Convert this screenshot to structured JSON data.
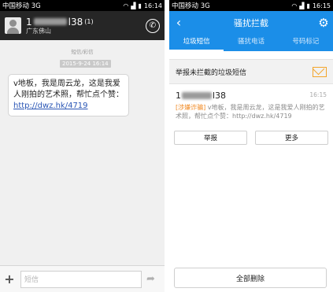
{
  "left": {
    "status": {
      "carrier": "中国移动 3G",
      "time": "16:14"
    },
    "contact": {
      "num_prefix": "1",
      "num_suffix": "l38",
      "count": "(1)",
      "location": "广东佛山"
    },
    "message_type": "短信/彩信",
    "timestamp": "2015-9-24 16:14",
    "message": {
      "text": "v地板，我是周云龙，这是我爱人刚拍的艺术照，帮忙点个赞：",
      "link": "http://dwz.hk/4719"
    },
    "input": {
      "placeholder": "短信"
    }
  },
  "right": {
    "status": {
      "carrier": "中国移动 3G",
      "time": "16:15"
    },
    "title": "骚扰拦截",
    "tabs": [
      {
        "label": "垃圾短信"
      },
      {
        "label": "骚扰电话"
      },
      {
        "label": "号码标记"
      }
    ],
    "report_bar": "举报未拦截的垃圾短信",
    "sms": {
      "num_prefix": "1",
      "num_suffix": "l38",
      "time": "16:15",
      "tag": "[涉嫌诈骗]",
      "body": "v地板，我是周云龙，这是我爱人刚拍的艺术照，帮忙点个赞：http://dwz.hk/4719"
    },
    "buttons": {
      "report": "举报",
      "more": "更多"
    },
    "delete_all": "全部删除"
  }
}
